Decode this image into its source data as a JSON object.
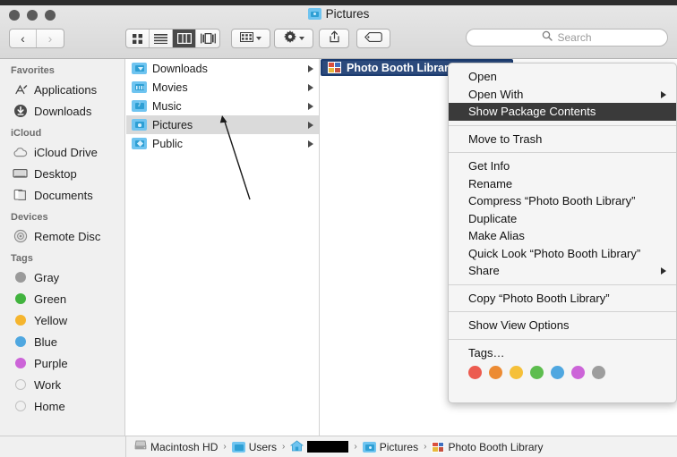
{
  "window": {
    "title": "Pictures",
    "title_icon": "pictures-folder-icon",
    "traffic_lights": [
      "close-button",
      "minimize-button",
      "zoom-button"
    ],
    "traffic_light_color": "#5b5b5b"
  },
  "toolbar": {
    "back_label": "‹",
    "forward_label": "›",
    "view_buttons": [
      {
        "name": "icon-view",
        "active": false
      },
      {
        "name": "list-view",
        "active": false
      },
      {
        "name": "column-view",
        "active": true
      },
      {
        "name": "gallery-view",
        "active": false
      }
    ],
    "arrange_label": "arrange-icon",
    "action_label": "gear-icon",
    "share_label": "share-icon",
    "tag_label": "tag-icon"
  },
  "search": {
    "placeholder": "Search",
    "icon": "search-icon"
  },
  "sidebar": {
    "sections": [
      {
        "header": "Favorites",
        "items": [
          {
            "label": "Applications",
            "icon": "applications-icon"
          },
          {
            "label": "Downloads",
            "icon": "downloads-icon"
          }
        ]
      },
      {
        "header": "iCloud",
        "items": [
          {
            "label": "iCloud Drive",
            "icon": "cloud-icon"
          },
          {
            "label": "Desktop",
            "icon": "desktop-icon"
          },
          {
            "label": "Documents",
            "icon": "documents-icon"
          }
        ]
      },
      {
        "header": "Devices",
        "items": [
          {
            "label": "Remote Disc",
            "icon": "disc-icon"
          }
        ]
      },
      {
        "header": "Tags",
        "items": [
          {
            "label": "Gray",
            "icon": "tag-dot",
            "color": "#9a9a9a"
          },
          {
            "label": "Green",
            "icon": "tag-dot",
            "color": "#41b33e"
          },
          {
            "label": "Yellow",
            "icon": "tag-dot",
            "color": "#f5b52e"
          },
          {
            "label": "Blue",
            "icon": "tag-dot",
            "color": "#4fa7e0"
          },
          {
            "label": "Purple",
            "icon": "tag-dot",
            "color": "#cc64d8"
          },
          {
            "label": "Work",
            "icon": "tag-dot-hollow",
            "color": ""
          },
          {
            "label": "Home",
            "icon": "tag-dot-hollow",
            "color": ""
          }
        ]
      }
    ]
  },
  "columns": {
    "first": [
      {
        "label": "Downloads",
        "icon": "downloads-folder-icon",
        "selected": false,
        "has_children": true
      },
      {
        "label": "Movies",
        "icon": "movies-folder-icon",
        "selected": false,
        "has_children": true
      },
      {
        "label": "Music",
        "icon": "music-folder-icon",
        "selected": false,
        "has_children": true
      },
      {
        "label": "Pictures",
        "icon": "pictures-folder-icon",
        "selected": true,
        "has_children": true
      },
      {
        "label": "Public",
        "icon": "public-folder-icon",
        "selected": false,
        "has_children": true
      }
    ],
    "second": [
      {
        "label": "Photo Booth Library",
        "icon": "photo-booth-library-icon",
        "selected": true
      }
    ]
  },
  "context_menu": {
    "groups": [
      {
        "items": [
          {
            "label": "Open",
            "submenu": false,
            "highlighted": false
          },
          {
            "label": "Open With",
            "submenu": true,
            "highlighted": false
          },
          {
            "label": "Show Package Contents",
            "submenu": false,
            "highlighted": true
          }
        ]
      },
      {
        "items": [
          {
            "label": "Move to Trash",
            "submenu": false,
            "highlighted": false
          }
        ]
      },
      {
        "items": [
          {
            "label": "Get Info",
            "submenu": false,
            "highlighted": false
          },
          {
            "label": "Rename",
            "submenu": false,
            "highlighted": false
          },
          {
            "label": "Compress “Photo Booth Library”",
            "submenu": false,
            "highlighted": false
          },
          {
            "label": "Duplicate",
            "submenu": false,
            "highlighted": false
          },
          {
            "label": "Make Alias",
            "submenu": false,
            "highlighted": false
          },
          {
            "label": "Quick Look “Photo Booth Library”",
            "submenu": false,
            "highlighted": false
          },
          {
            "label": "Share",
            "submenu": true,
            "highlighted": false
          }
        ]
      },
      {
        "items": [
          {
            "label": "Copy “Photo Booth Library”",
            "submenu": false,
            "highlighted": false
          }
        ]
      },
      {
        "items": [
          {
            "label": "Show View Options",
            "submenu": false,
            "highlighted": false
          }
        ]
      },
      {
        "items": [
          {
            "label": "Tags…",
            "submenu": false,
            "highlighted": false
          }
        ]
      }
    ],
    "tag_colors": [
      "#ec5b4f",
      "#ec8b33",
      "#f5c039",
      "#5dbd4e",
      "#4fa7e0",
      "#cc64d8",
      "#9d9d9d"
    ],
    "highlight_color": "#3a3a3a"
  },
  "path_bar": {
    "items": [
      {
        "label": "Macintosh HD",
        "icon": "hard-drive-icon",
        "redacted": false
      },
      {
        "label": "Users",
        "icon": "users-folder-icon",
        "redacted": false
      },
      {
        "label": "",
        "icon": "home-folder-icon",
        "redacted": true
      },
      {
        "label": "Pictures",
        "icon": "pictures-folder-icon",
        "redacted": false
      },
      {
        "label": "Photo Booth Library",
        "icon": "photo-booth-library-icon",
        "redacted": false
      }
    ],
    "separator": "›"
  },
  "annotation": {
    "type": "arrow",
    "points_to": "Pictures",
    "color": "#1a1a1a"
  }
}
